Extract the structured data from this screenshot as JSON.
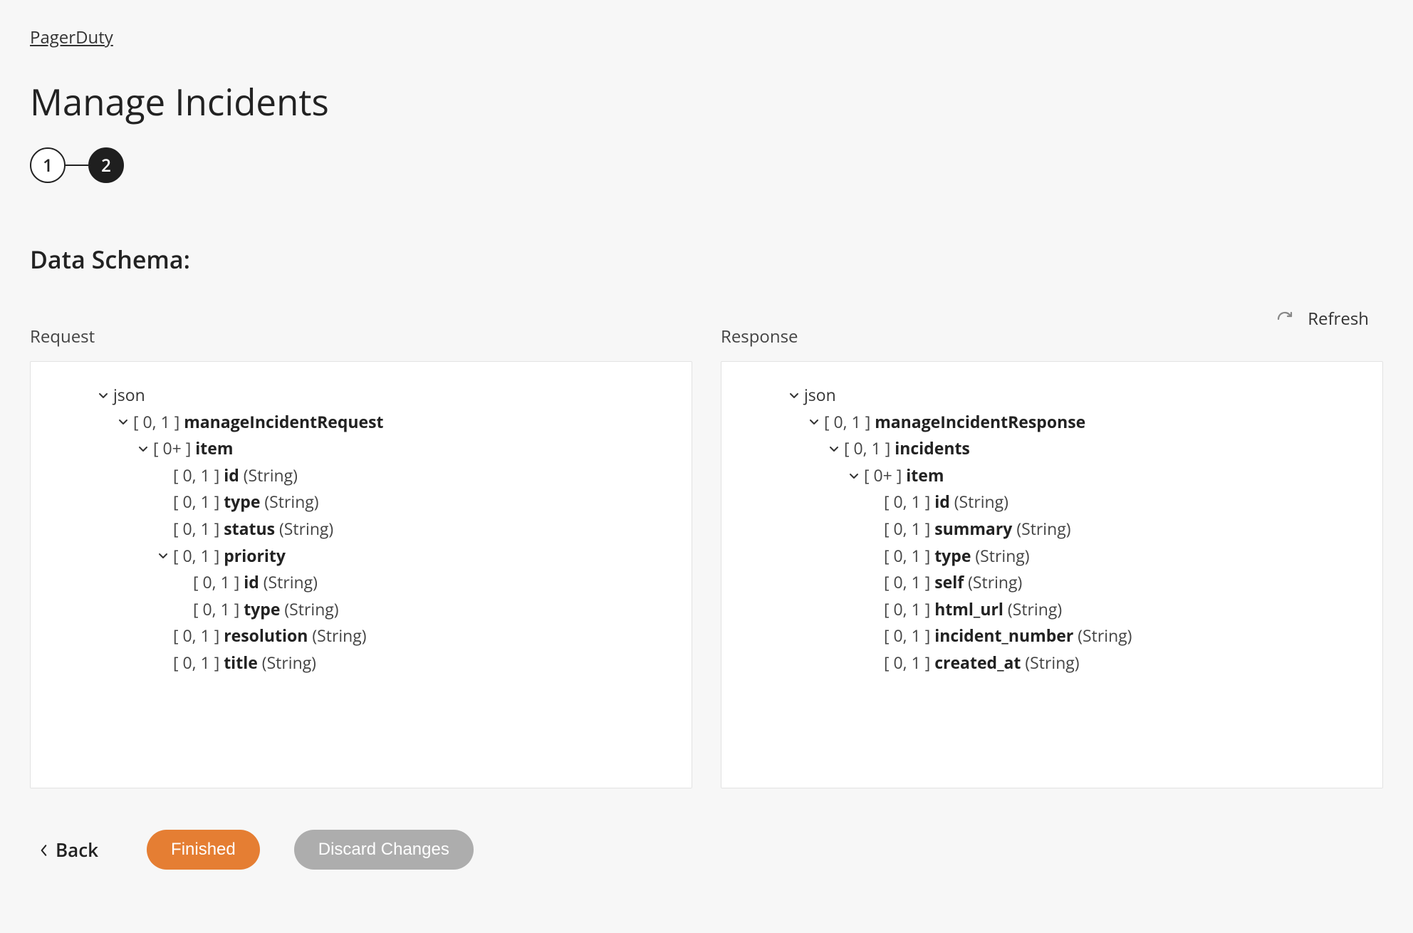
{
  "breadcrumb": "PagerDuty",
  "page_title": "Manage Incidents",
  "steps": [
    "1",
    "2"
  ],
  "active_step_index": 1,
  "section_title": "Data Schema:",
  "refresh_label": "Refresh",
  "columns": {
    "request": {
      "header": "Request",
      "tree": [
        {
          "indent": 0,
          "expandable": true,
          "label": "json"
        },
        {
          "indent": 1,
          "expandable": true,
          "card": "[ 0, 1 ]",
          "name": "manageIncidentRequest"
        },
        {
          "indent": 2,
          "expandable": true,
          "card": "[ 0+ ]",
          "name": "item"
        },
        {
          "indent": 3,
          "expandable": false,
          "card": "[ 0, 1 ]",
          "name": "id",
          "type": "(String)"
        },
        {
          "indent": 3,
          "expandable": false,
          "card": "[ 0, 1 ]",
          "name": "type",
          "type": "(String)"
        },
        {
          "indent": 3,
          "expandable": false,
          "card": "[ 0, 1 ]",
          "name": "status",
          "type": "(String)"
        },
        {
          "indent": 3,
          "expandable": true,
          "card": "[ 0, 1 ]",
          "name": "priority"
        },
        {
          "indent": 4,
          "expandable": false,
          "card": "[ 0, 1 ]",
          "name": "id",
          "type": "(String)"
        },
        {
          "indent": 4,
          "expandable": false,
          "card": "[ 0, 1 ]",
          "name": "type",
          "type": "(String)"
        },
        {
          "indent": 3,
          "expandable": false,
          "card": "[ 0, 1 ]",
          "name": "resolution",
          "type": "(String)"
        },
        {
          "indent": 3,
          "expandable": false,
          "card": "[ 0, 1 ]",
          "name": "title",
          "type": "(String)"
        }
      ]
    },
    "response": {
      "header": "Response",
      "tree": [
        {
          "indent": 0,
          "expandable": true,
          "label": "json"
        },
        {
          "indent": 1,
          "expandable": true,
          "card": "[ 0, 1 ]",
          "name": "manageIncidentResponse"
        },
        {
          "indent": 2,
          "expandable": true,
          "card": "[ 0, 1 ]",
          "name": "incidents"
        },
        {
          "indent": 3,
          "expandable": true,
          "card": "[ 0+ ]",
          "name": "item"
        },
        {
          "indent": 4,
          "expandable": false,
          "card": "[ 0, 1 ]",
          "name": "id",
          "type": "(String)"
        },
        {
          "indent": 4,
          "expandable": false,
          "card": "[ 0, 1 ]",
          "name": "summary",
          "type": "(String)"
        },
        {
          "indent": 4,
          "expandable": false,
          "card": "[ 0, 1 ]",
          "name": "type",
          "type": "(String)"
        },
        {
          "indent": 4,
          "expandable": false,
          "card": "[ 0, 1 ]",
          "name": "self",
          "type": "(String)"
        },
        {
          "indent": 4,
          "expandable": false,
          "card": "[ 0, 1 ]",
          "name": "html_url",
          "type": "(String)"
        },
        {
          "indent": 4,
          "expandable": false,
          "card": "[ 0, 1 ]",
          "name": "incident_number",
          "type": "(String)"
        },
        {
          "indent": 4,
          "expandable": false,
          "card": "[ 0, 1 ]",
          "name": "created_at",
          "type": "(String)"
        }
      ]
    }
  },
  "footer": {
    "back": "Back",
    "finished": "Finished",
    "discard": "Discard Changes"
  }
}
